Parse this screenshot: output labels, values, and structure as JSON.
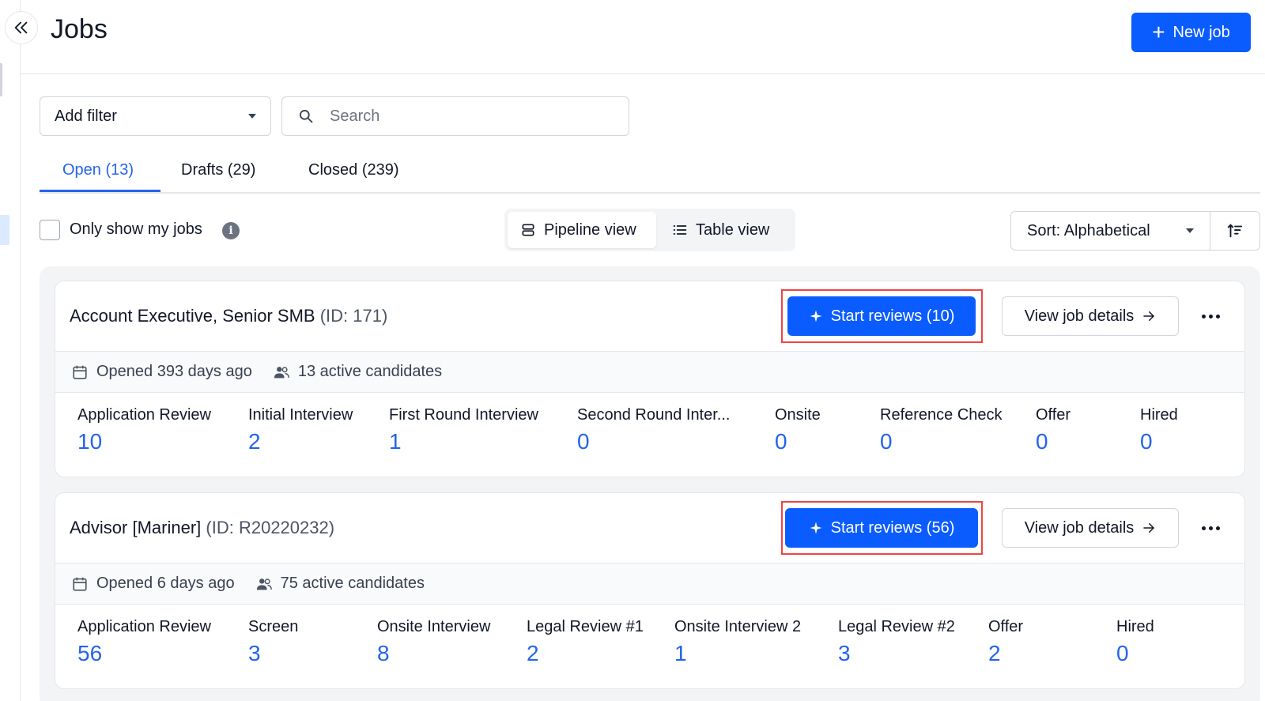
{
  "page": {
    "title": "Jobs"
  },
  "header": {
    "new_job_label": "New job"
  },
  "filters": {
    "add_filter_label": "Add filter",
    "search_placeholder": "Search",
    "search_value": ""
  },
  "tabs": [
    {
      "label": "Open (13)",
      "active": true
    },
    {
      "label": "Drafts (29)",
      "active": false
    },
    {
      "label": "Closed (239)",
      "active": false
    }
  ],
  "toolbar": {
    "only_my_jobs_label": "Only show my jobs",
    "only_my_jobs_checked": false,
    "pipeline_view_label": "Pipeline view",
    "table_view_label": "Table view",
    "active_view": "pipeline",
    "sort_label": "Sort: Alphabetical"
  },
  "colors": {
    "primary": "#0a5cff",
    "link": "#2563eb",
    "highlight": "#ef4444"
  },
  "jobs": [
    {
      "title": "Account Executive, Senior SMB",
      "id_text": "(ID: 171)",
      "start_reviews_label": "Start reviews (10)",
      "view_details_label": "View job details",
      "opened": "Opened 393 days ago",
      "candidates": "13 active candidates",
      "stages": [
        {
          "name": "Application Review",
          "count": "10"
        },
        {
          "name": "Initial Interview",
          "count": "2"
        },
        {
          "name": "First Round Interview",
          "count": "1"
        },
        {
          "name": "Second Round Inter...",
          "count": "0"
        },
        {
          "name": "Onsite",
          "count": "0"
        },
        {
          "name": "Reference Check",
          "count": "0"
        },
        {
          "name": "Offer",
          "count": "0"
        },
        {
          "name": "Hired",
          "count": "0"
        }
      ]
    },
    {
      "title": "Advisor [Mariner]",
      "id_text": "(ID: R20220232)",
      "start_reviews_label": "Start reviews (56)",
      "view_details_label": "View job details",
      "opened": "Opened 6 days ago",
      "candidates": "75 active candidates",
      "stages": [
        {
          "name": "Application Review",
          "count": "56"
        },
        {
          "name": "Screen",
          "count": "3"
        },
        {
          "name": "Onsite Interview",
          "count": "8"
        },
        {
          "name": "Legal Review #1",
          "count": "2"
        },
        {
          "name": "Onsite Interview 2",
          "count": "1"
        },
        {
          "name": "Legal Review #2",
          "count": "3"
        },
        {
          "name": "Offer",
          "count": "2"
        },
        {
          "name": "Hired",
          "count": "0"
        }
      ]
    }
  ]
}
